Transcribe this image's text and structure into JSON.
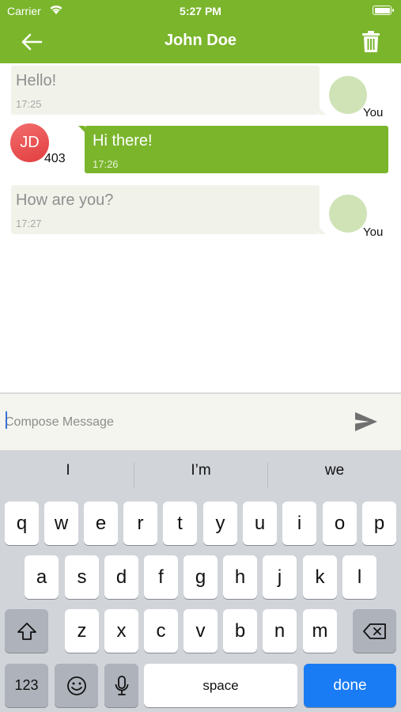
{
  "status_bar": {
    "carrier": "Carrier",
    "time": "5:27 PM"
  },
  "header": {
    "title": "John Doe",
    "back_icon": "arrow-left-icon",
    "delete_icon": "trash-icon"
  },
  "messages": [
    {
      "text": "Hello!",
      "time": "17:25",
      "sender": "You",
      "direction": "in"
    },
    {
      "text": "Hi there!",
      "time": "17:26",
      "sender_initials": "JD",
      "sender_count": "403",
      "direction": "out"
    },
    {
      "text": "How are you?",
      "time": "17:27",
      "sender": "You",
      "direction": "in"
    }
  ],
  "compose": {
    "placeholder": "Compose Message",
    "value": ""
  },
  "keyboard": {
    "suggestions": [
      "I",
      "I’m",
      "we"
    ],
    "row1": [
      "q",
      "w",
      "e",
      "r",
      "t",
      "y",
      "u",
      "i",
      "o",
      "p"
    ],
    "row2": [
      "a",
      "s",
      "d",
      "f",
      "g",
      "h",
      "j",
      "k",
      "l"
    ],
    "row3": [
      "z",
      "x",
      "c",
      "v",
      "b",
      "n",
      "m"
    ],
    "numbers_label": "123",
    "space_label": "space",
    "done_label": "done"
  },
  "colors": {
    "accent": "#7ab52c",
    "bubble_in": "#f1f3ea",
    "avatar_self": "#cfe3b7",
    "avatar_jd": "#ea4f4f",
    "done_key": "#1a7cf4"
  }
}
